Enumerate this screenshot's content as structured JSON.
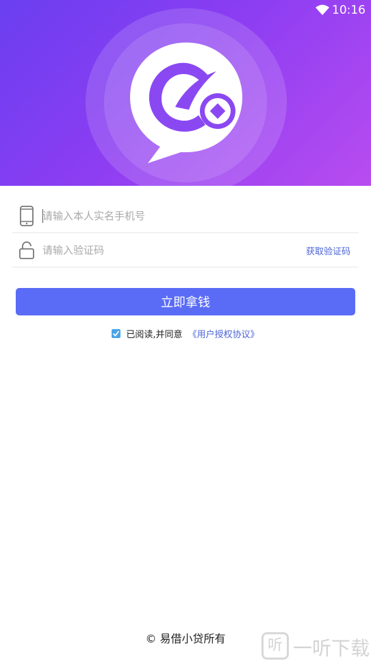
{
  "status_bar": {
    "time": "10:16"
  },
  "login": {
    "phone_placeholder": "请输入本人实名手机号",
    "code_placeholder": "请输入验证码",
    "get_code_label": "获取验证码",
    "submit_label": "立即拿钱",
    "agree_text": "已阅读,并同意",
    "agreement_link": "《用户授权协议》",
    "agree_checked": true
  },
  "footer": {
    "copyright": "© 易借小贷所有"
  },
  "watermark": {
    "icon_text": "听",
    "text": "一听下载"
  },
  "colors": {
    "hero_start": "#6a3ff0",
    "hero_end": "#b84cf0",
    "primary_button": "#5a6cf6",
    "link": "#4a63d8",
    "checkbox": "#4aa3e8"
  },
  "icons": [
    "wifi-icon",
    "app-logo-icon",
    "phone-icon",
    "lock-icon",
    "check-icon"
  ]
}
